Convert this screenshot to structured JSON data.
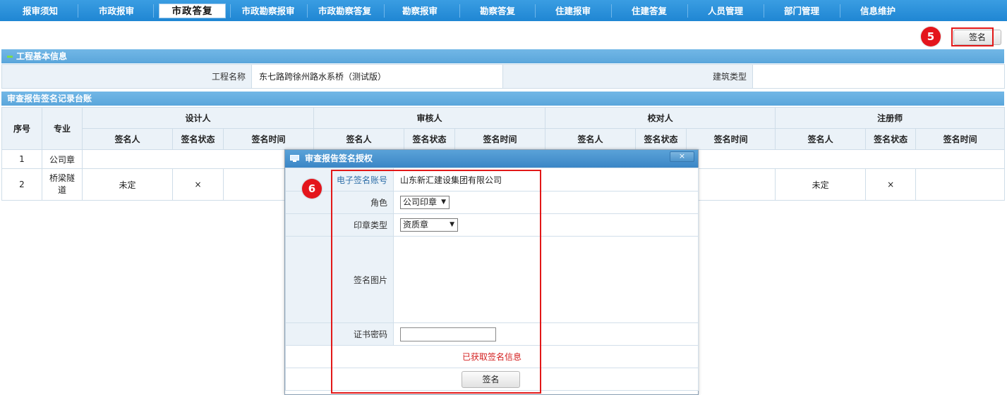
{
  "nav": {
    "items": [
      "报审须知",
      "市政报审",
      "市政答复",
      "市政勘察报审",
      "市政勘察答复",
      "勘察报审",
      "勘察答复",
      "住建报审",
      "住建答复",
      "人员管理",
      "部门管理",
      "信息维护"
    ],
    "active": "市政答复"
  },
  "toolbar": {
    "sign_label": "签名",
    "step_badge": "5"
  },
  "basic_info": {
    "title": "工程基本信息",
    "project_name_label": "工程名称",
    "project_name_value": "东七路跨徐州路水系桥（测试版）",
    "building_type_label": "建筑类型",
    "building_type_value": ""
  },
  "ledger": {
    "title": "审查报告签名记录台账",
    "col_index": "序号",
    "col_specialty": "专业",
    "groups": [
      "设计人",
      "审核人",
      "校对人",
      "注册师"
    ],
    "subcols": [
      "签名人",
      "签名状态",
      "签名时间"
    ],
    "rows": [
      {
        "index": "1",
        "specialty": "公司章"
      },
      {
        "index": "2",
        "specialty": "桥梁隧道",
        "designer_signer": "未定",
        "designer_status": "×",
        "reg_signer": "未定",
        "reg_status": "×"
      }
    ]
  },
  "dialog": {
    "title": "审查报告签名授权",
    "close_label": "×",
    "step_badge": "6",
    "account_label": "电子签名账号",
    "account_value": "山东新汇建设集团有限公司",
    "role_label": "角色",
    "role_value": "公司印章",
    "seal_type_label": "印章类型",
    "seal_type_value": "资质章",
    "image_label": "签名图片",
    "password_label": "证书密码",
    "status_message": "已获取签名信息",
    "sign_label": "签名"
  },
  "colors": {
    "nav_bg": "#1f86d3",
    "section_bar": "#5aa6db",
    "highlight": "#e21818",
    "status_text": "#d42020"
  }
}
